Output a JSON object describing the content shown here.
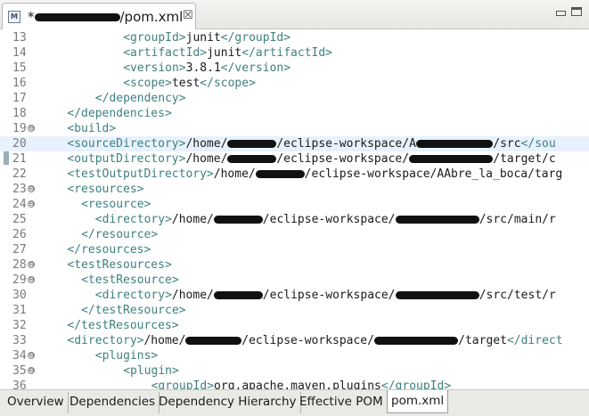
{
  "tab": {
    "title_prefix": "*",
    "title_suffix": "/pom.xml",
    "close_glyph": "☒",
    "file_icon_letter": "M"
  },
  "editor": {
    "lines": [
      {
        "num": "13",
        "indent": 12,
        "fold": "",
        "parts": [
          [
            "tg",
            "<groupId>"
          ],
          [
            "tx",
            "junit"
          ],
          [
            "tg",
            "</groupId>"
          ]
        ]
      },
      {
        "num": "14",
        "indent": 12,
        "fold": "",
        "parts": [
          [
            "tg",
            "<artifactId>"
          ],
          [
            "tx",
            "junit"
          ],
          [
            "tg",
            "</artifactId>"
          ]
        ]
      },
      {
        "num": "15",
        "indent": 12,
        "fold": "",
        "parts": [
          [
            "tg",
            "<version>"
          ],
          [
            "tx",
            "3.8.1"
          ],
          [
            "tg",
            "</version>"
          ]
        ]
      },
      {
        "num": "16",
        "indent": 12,
        "fold": "",
        "parts": [
          [
            "tg",
            "<scope>"
          ],
          [
            "tx",
            "test"
          ],
          [
            "tg",
            "</scope>"
          ]
        ]
      },
      {
        "num": "17",
        "indent": 8,
        "fold": "",
        "parts": [
          [
            "tg",
            "</dependency>"
          ]
        ]
      },
      {
        "num": "18",
        "indent": 4,
        "fold": "",
        "parts": [
          [
            "tg",
            "</dependencies>"
          ]
        ]
      },
      {
        "num": "19",
        "indent": 4,
        "fold": "⊖",
        "parts": [
          [
            "tg",
            "<build>"
          ]
        ]
      },
      {
        "num": "20",
        "indent": 4,
        "fold": "",
        "current": true,
        "parts": [
          [
            "tg",
            "<sourceDirectory>"
          ],
          [
            "tx",
            "/home/"
          ],
          [
            "r",
            "7"
          ],
          [
            "tx",
            "/eclipse-workspace/A"
          ],
          [
            "r",
            "11"
          ],
          [
            "tx",
            "/src"
          ],
          [
            "tg",
            "</sou"
          ]
        ]
      },
      {
        "num": "21",
        "indent": 4,
        "fold": "",
        "parts": [
          [
            "tg",
            "<outputDirectory>"
          ],
          [
            "tx",
            "/home/"
          ],
          [
            "r",
            "7"
          ],
          [
            "tx",
            "/eclipse-workspace/"
          ],
          [
            "r",
            "12"
          ],
          [
            "tx",
            "/target/c"
          ]
        ]
      },
      {
        "num": "22",
        "indent": 4,
        "fold": "",
        "parts": [
          [
            "tg",
            "<testOutputDirectory>"
          ],
          [
            "tx",
            "/home/"
          ],
          [
            "r",
            "7"
          ],
          [
            "tx",
            "/eclipse-workspace/AAbre_la_boca/targ"
          ]
        ]
      },
      {
        "num": "23",
        "indent": 4,
        "fold": "⊖",
        "parts": [
          [
            "tg",
            "<resources>"
          ]
        ]
      },
      {
        "num": "24",
        "indent": 6,
        "fold": "⊖",
        "parts": [
          [
            "tg",
            "<resource>"
          ]
        ]
      },
      {
        "num": "25",
        "indent": 8,
        "fold": "",
        "parts": [
          [
            "tg",
            "<directory>"
          ],
          [
            "tx",
            "/home/"
          ],
          [
            "r",
            "7"
          ],
          [
            "tx",
            "/eclipse-workspace/"
          ],
          [
            "r",
            "12"
          ],
          [
            "tx",
            "/src/main/r"
          ]
        ]
      },
      {
        "num": "26",
        "indent": 6,
        "fold": "",
        "parts": [
          [
            "tg",
            "</resource>"
          ]
        ]
      },
      {
        "num": "27",
        "indent": 4,
        "fold": "",
        "parts": [
          [
            "tg",
            "</resources>"
          ]
        ]
      },
      {
        "num": "28",
        "indent": 4,
        "fold": "⊖",
        "parts": [
          [
            "tg",
            "<testResources>"
          ]
        ]
      },
      {
        "num": "29",
        "indent": 6,
        "fold": "⊖",
        "parts": [
          [
            "tg",
            "<testResource>"
          ]
        ]
      },
      {
        "num": "30",
        "indent": 8,
        "fold": "",
        "parts": [
          [
            "tg",
            "<directory>"
          ],
          [
            "tx",
            "/home/"
          ],
          [
            "r",
            "7"
          ],
          [
            "tx",
            "/eclipse-workspace/"
          ],
          [
            "r",
            "12"
          ],
          [
            "tx",
            "/src/test/r"
          ]
        ]
      },
      {
        "num": "31",
        "indent": 6,
        "fold": "",
        "parts": [
          [
            "tg",
            "</testResource>"
          ]
        ]
      },
      {
        "num": "32",
        "indent": 4,
        "fold": "",
        "parts": [
          [
            "tg",
            "</testResources>"
          ]
        ]
      },
      {
        "num": "33",
        "indent": 4,
        "fold": "",
        "parts": [
          [
            "tg",
            "<directory>"
          ],
          [
            "tx",
            "/home/"
          ],
          [
            "r",
            "8"
          ],
          [
            "tx",
            "/eclipse-workspace/"
          ],
          [
            "r",
            "12"
          ],
          [
            "tx",
            "/target"
          ],
          [
            "tg",
            "</direct"
          ]
        ]
      },
      {
        "num": "34",
        "indent": 8,
        "fold": "⊖",
        "parts": [
          [
            "tg",
            "<plugins>"
          ]
        ]
      },
      {
        "num": "35",
        "indent": 12,
        "fold": "⊖",
        "parts": [
          [
            "tg",
            "<plugin>"
          ]
        ]
      },
      {
        "num": "36",
        "indent": 16,
        "fold": "",
        "parts": [
          [
            "tg",
            "<groupId>"
          ],
          [
            "tx",
            "org.apache.maven.plugins"
          ],
          [
            "tg",
            "</groupId>"
          ]
        ]
      }
    ]
  },
  "page_tabs": [
    {
      "label": "Overview",
      "active": false
    },
    {
      "label": "Dependencies",
      "active": false
    },
    {
      "label": "Dependency Hierarchy",
      "active": false
    },
    {
      "label": "Effective POM",
      "active": false
    },
    {
      "label": "pom.xml",
      "active": true
    }
  ],
  "colors": {
    "tag": "#3f7f7f",
    "text": "#1a1a1a",
    "current_line": "#e8f2fe"
  }
}
